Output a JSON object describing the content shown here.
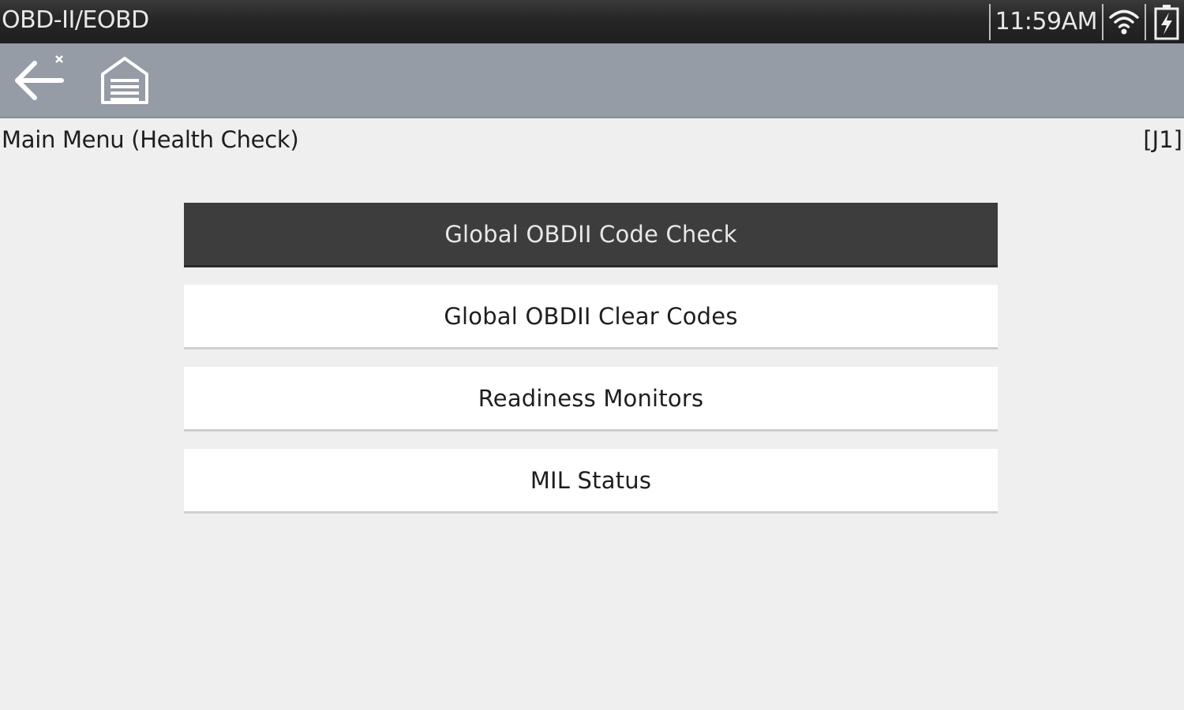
{
  "status_bar": {
    "app_title": "OBD-II/EOBD",
    "clock": "11:59AM",
    "icons": [
      "wifi-icon",
      "battery-charging-icon"
    ]
  },
  "toolbar": {
    "buttons": [
      {
        "name": "back-button",
        "icon": "back-arrow-icon"
      },
      {
        "name": "home-button",
        "icon": "garage-home-icon"
      }
    ]
  },
  "header": {
    "title": "Main Menu (Health Check)",
    "code": "[J1]"
  },
  "menu": {
    "items": [
      {
        "label": "Global OBDII Code Check",
        "selected": true
      },
      {
        "label": "Global OBDII Clear Codes",
        "selected": false
      },
      {
        "label": "Readiness Monitors",
        "selected": false
      },
      {
        "label": "MIL Status",
        "selected": false
      }
    ]
  },
  "colors": {
    "status_bar_bg": "#262626",
    "toolbar_bg": "#969ca5",
    "page_bg": "#efefef",
    "selected_item_bg": "#3d3d3d",
    "item_bg": "#ffffff"
  }
}
